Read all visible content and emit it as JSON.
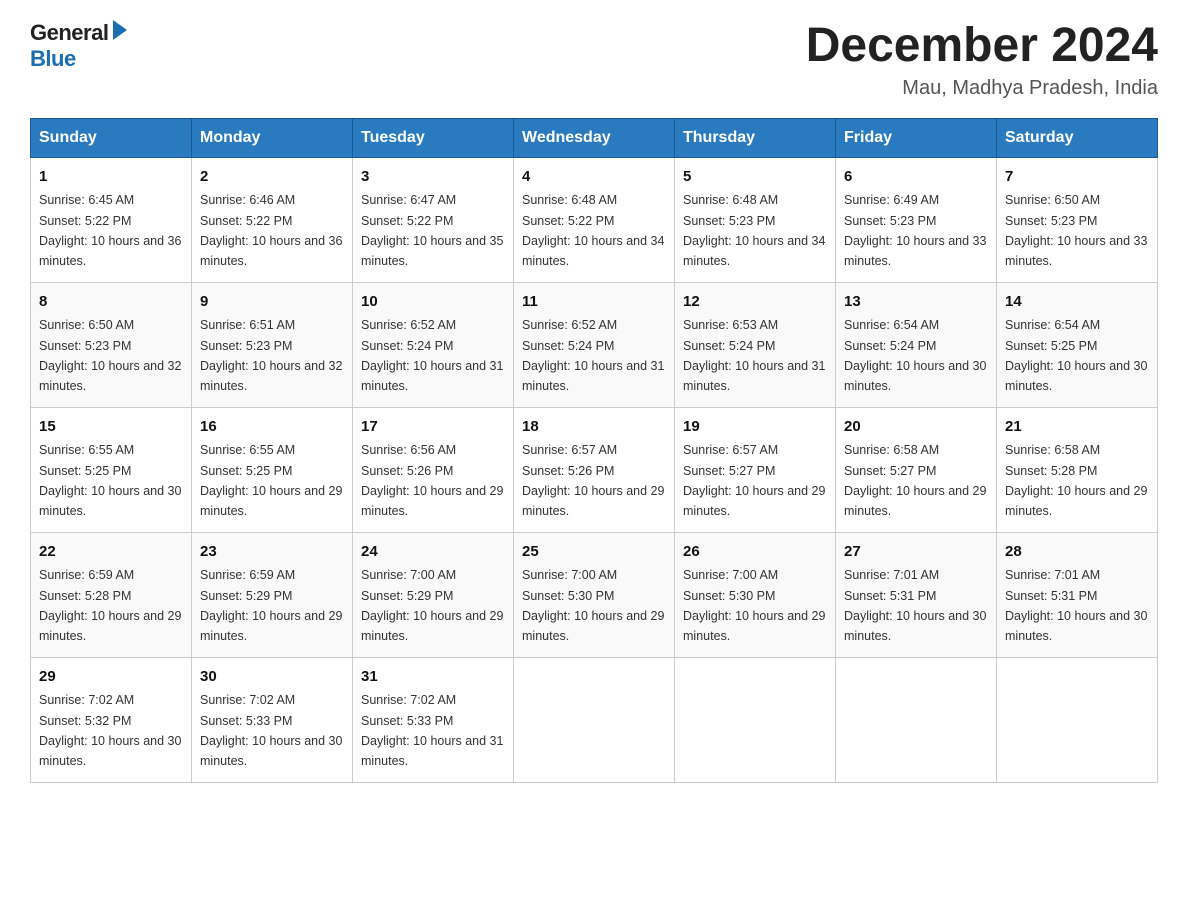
{
  "logo": {
    "general": "General",
    "blue": "Blue"
  },
  "title": "December 2024",
  "subtitle": "Mau, Madhya Pradesh, India",
  "days_of_week": [
    "Sunday",
    "Monday",
    "Tuesday",
    "Wednesday",
    "Thursday",
    "Friday",
    "Saturday"
  ],
  "weeks": [
    [
      {
        "day": "1",
        "sunrise": "6:45 AM",
        "sunset": "5:22 PM",
        "daylight": "10 hours and 36 minutes."
      },
      {
        "day": "2",
        "sunrise": "6:46 AM",
        "sunset": "5:22 PM",
        "daylight": "10 hours and 36 minutes."
      },
      {
        "day": "3",
        "sunrise": "6:47 AM",
        "sunset": "5:22 PM",
        "daylight": "10 hours and 35 minutes."
      },
      {
        "day": "4",
        "sunrise": "6:48 AM",
        "sunset": "5:22 PM",
        "daylight": "10 hours and 34 minutes."
      },
      {
        "day": "5",
        "sunrise": "6:48 AM",
        "sunset": "5:23 PM",
        "daylight": "10 hours and 34 minutes."
      },
      {
        "day": "6",
        "sunrise": "6:49 AM",
        "sunset": "5:23 PM",
        "daylight": "10 hours and 33 minutes."
      },
      {
        "day": "7",
        "sunrise": "6:50 AM",
        "sunset": "5:23 PM",
        "daylight": "10 hours and 33 minutes."
      }
    ],
    [
      {
        "day": "8",
        "sunrise": "6:50 AM",
        "sunset": "5:23 PM",
        "daylight": "10 hours and 32 minutes."
      },
      {
        "day": "9",
        "sunrise": "6:51 AM",
        "sunset": "5:23 PM",
        "daylight": "10 hours and 32 minutes."
      },
      {
        "day": "10",
        "sunrise": "6:52 AM",
        "sunset": "5:24 PM",
        "daylight": "10 hours and 31 minutes."
      },
      {
        "day": "11",
        "sunrise": "6:52 AM",
        "sunset": "5:24 PM",
        "daylight": "10 hours and 31 minutes."
      },
      {
        "day": "12",
        "sunrise": "6:53 AM",
        "sunset": "5:24 PM",
        "daylight": "10 hours and 31 minutes."
      },
      {
        "day": "13",
        "sunrise": "6:54 AM",
        "sunset": "5:24 PM",
        "daylight": "10 hours and 30 minutes."
      },
      {
        "day": "14",
        "sunrise": "6:54 AM",
        "sunset": "5:25 PM",
        "daylight": "10 hours and 30 minutes."
      }
    ],
    [
      {
        "day": "15",
        "sunrise": "6:55 AM",
        "sunset": "5:25 PM",
        "daylight": "10 hours and 30 minutes."
      },
      {
        "day": "16",
        "sunrise": "6:55 AM",
        "sunset": "5:25 PM",
        "daylight": "10 hours and 29 minutes."
      },
      {
        "day": "17",
        "sunrise": "6:56 AM",
        "sunset": "5:26 PM",
        "daylight": "10 hours and 29 minutes."
      },
      {
        "day": "18",
        "sunrise": "6:57 AM",
        "sunset": "5:26 PM",
        "daylight": "10 hours and 29 minutes."
      },
      {
        "day": "19",
        "sunrise": "6:57 AM",
        "sunset": "5:27 PM",
        "daylight": "10 hours and 29 minutes."
      },
      {
        "day": "20",
        "sunrise": "6:58 AM",
        "sunset": "5:27 PM",
        "daylight": "10 hours and 29 minutes."
      },
      {
        "day": "21",
        "sunrise": "6:58 AM",
        "sunset": "5:28 PM",
        "daylight": "10 hours and 29 minutes."
      }
    ],
    [
      {
        "day": "22",
        "sunrise": "6:59 AM",
        "sunset": "5:28 PM",
        "daylight": "10 hours and 29 minutes."
      },
      {
        "day": "23",
        "sunrise": "6:59 AM",
        "sunset": "5:29 PM",
        "daylight": "10 hours and 29 minutes."
      },
      {
        "day": "24",
        "sunrise": "7:00 AM",
        "sunset": "5:29 PM",
        "daylight": "10 hours and 29 minutes."
      },
      {
        "day": "25",
        "sunrise": "7:00 AM",
        "sunset": "5:30 PM",
        "daylight": "10 hours and 29 minutes."
      },
      {
        "day": "26",
        "sunrise": "7:00 AM",
        "sunset": "5:30 PM",
        "daylight": "10 hours and 29 minutes."
      },
      {
        "day": "27",
        "sunrise": "7:01 AM",
        "sunset": "5:31 PM",
        "daylight": "10 hours and 30 minutes."
      },
      {
        "day": "28",
        "sunrise": "7:01 AM",
        "sunset": "5:31 PM",
        "daylight": "10 hours and 30 minutes."
      }
    ],
    [
      {
        "day": "29",
        "sunrise": "7:02 AM",
        "sunset": "5:32 PM",
        "daylight": "10 hours and 30 minutes."
      },
      {
        "day": "30",
        "sunrise": "7:02 AM",
        "sunset": "5:33 PM",
        "daylight": "10 hours and 30 minutes."
      },
      {
        "day": "31",
        "sunrise": "7:02 AM",
        "sunset": "5:33 PM",
        "daylight": "10 hours and 31 minutes."
      },
      null,
      null,
      null,
      null
    ]
  ]
}
